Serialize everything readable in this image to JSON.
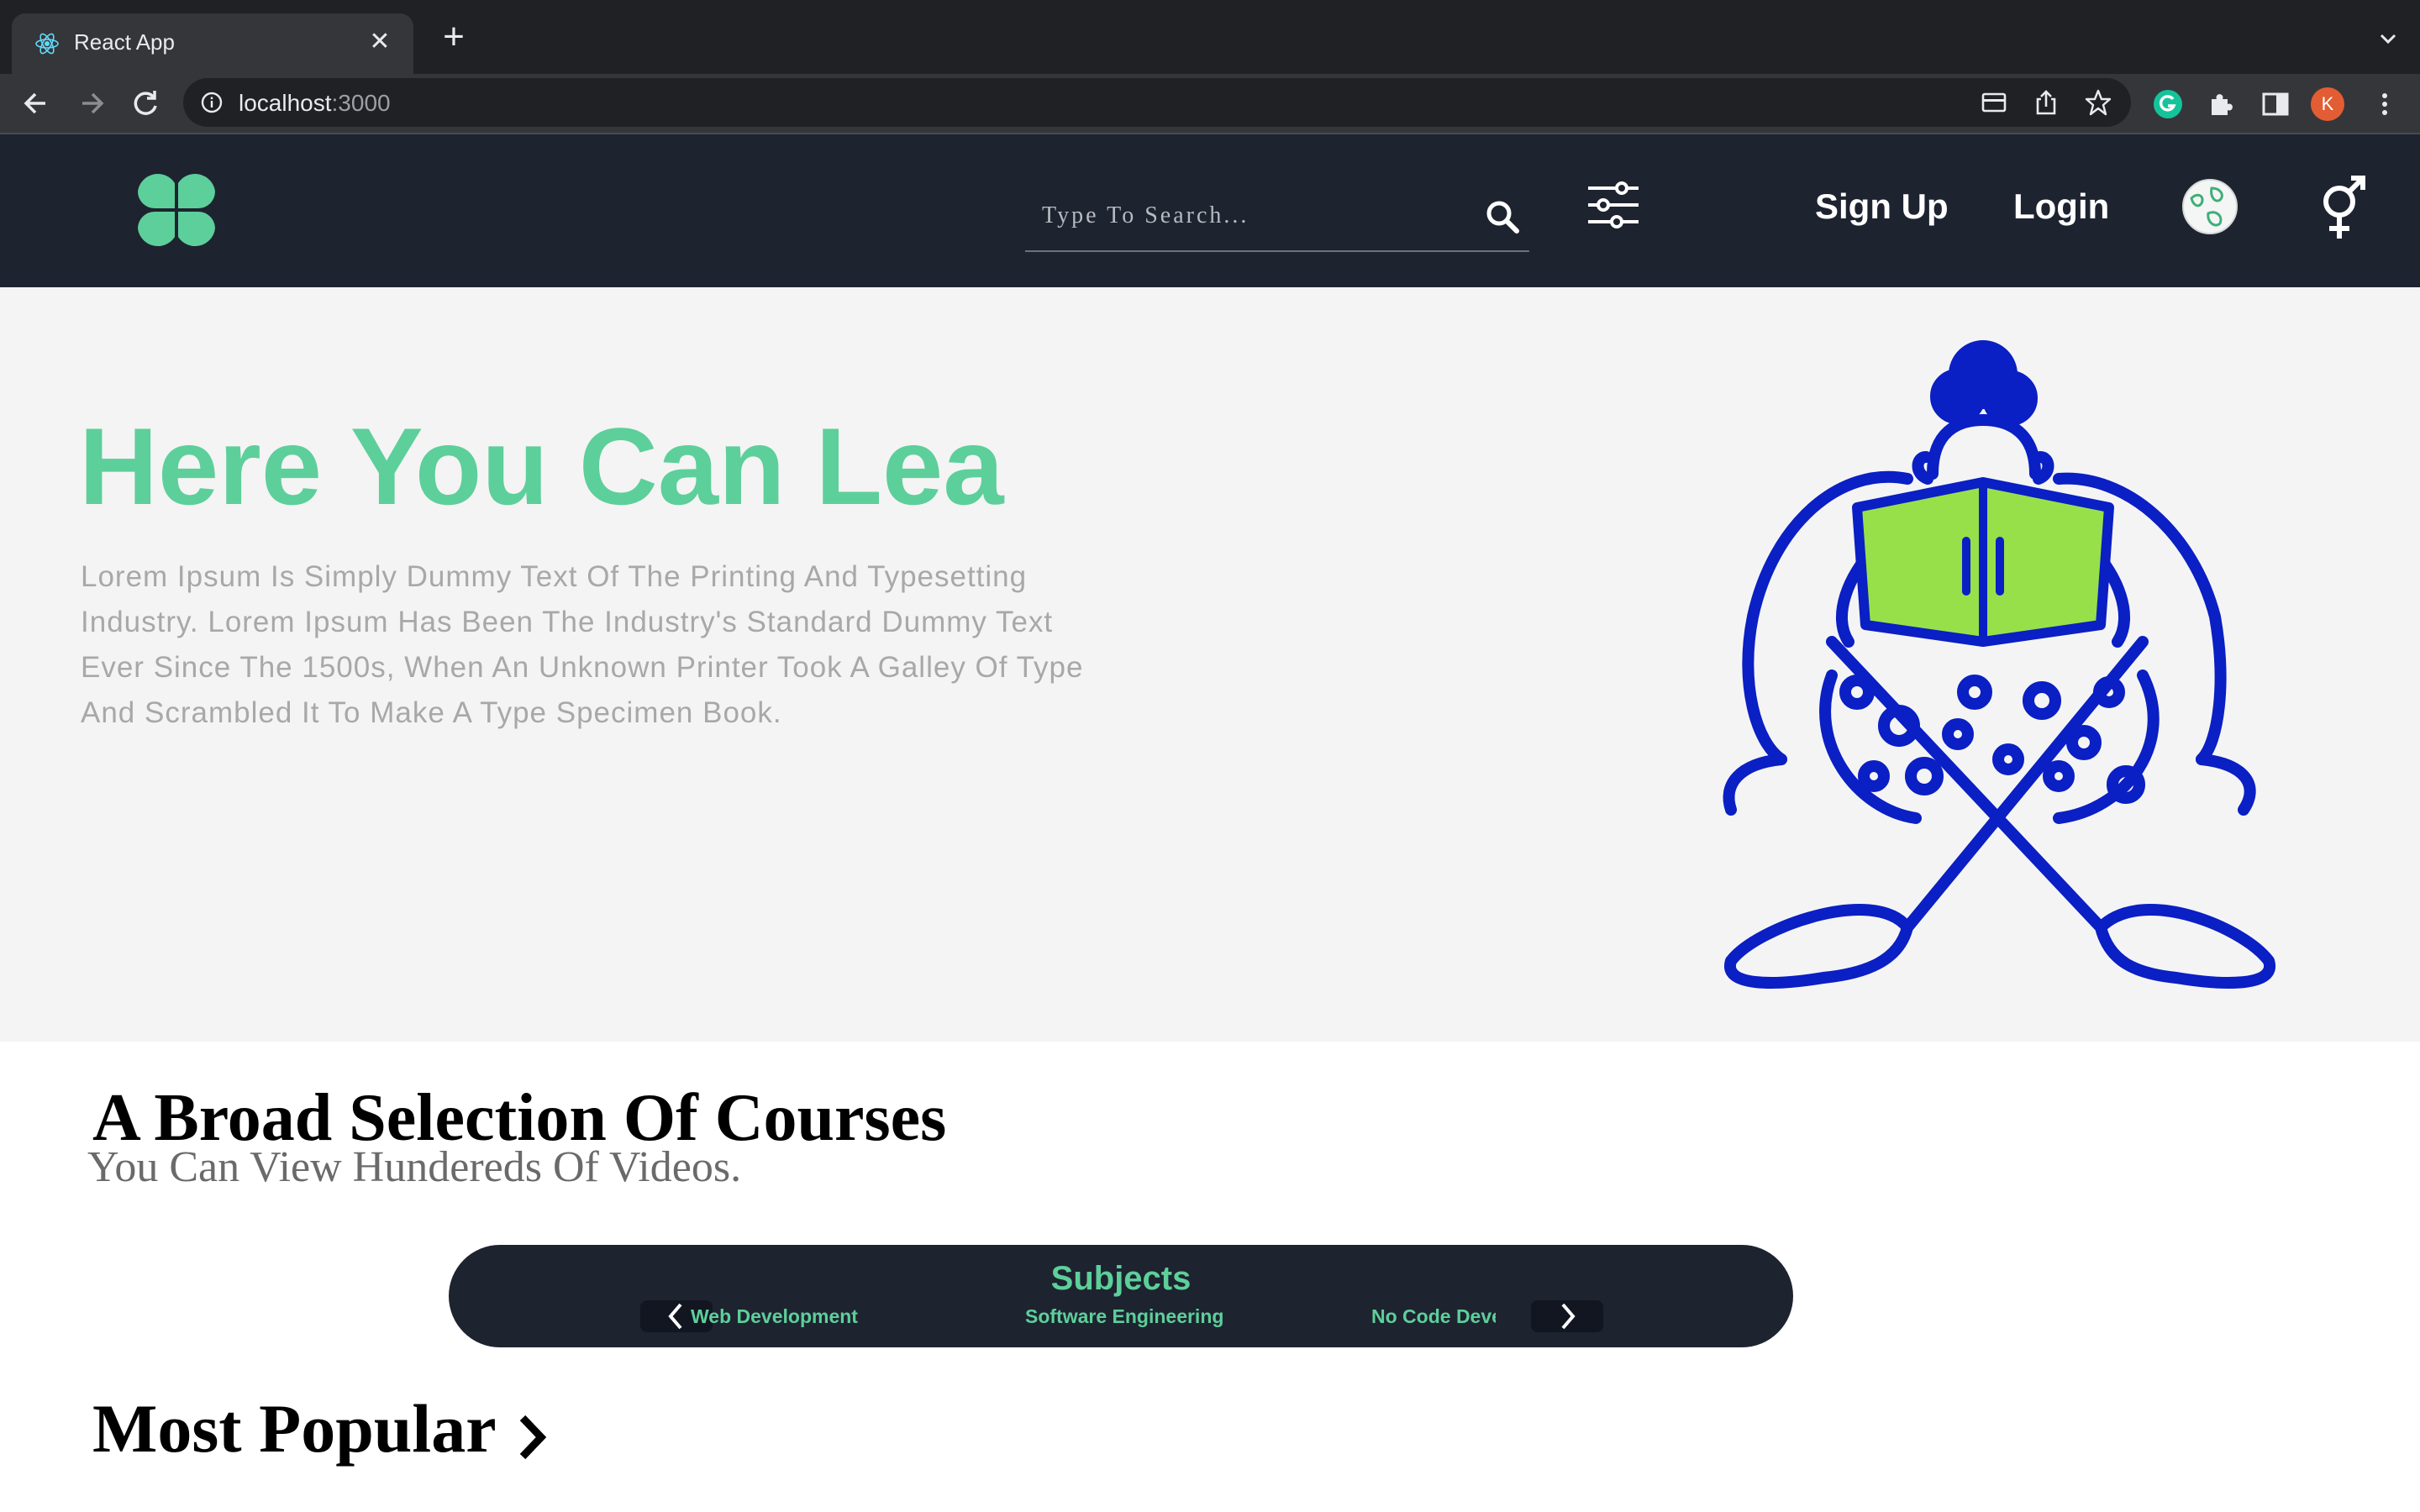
{
  "browser": {
    "tab_title": "React App",
    "url_host": "localhost",
    "url_port": ":3000",
    "profile_initial": "K"
  },
  "header": {
    "search_placeholder": "Type To Search...",
    "signup_label": "Sign Up",
    "login_label": "Login"
  },
  "hero": {
    "title": "Here You Can Lea",
    "text": "Lorem Ipsum Is Simply Dummy Text Of The Printing And Typesetting Industry. Lorem Ipsum Has Been The Industry's Standard Dummy Text Ever Since The 1500s, When An Unknown Printer Took A Galley Of Type And Scrambled It To Make A Type Specimen Book."
  },
  "courses": {
    "title": "A Broad Selection Of Courses",
    "subtitle": "You Can View Hundereds Of Videos."
  },
  "subjects": {
    "title": "Subjects",
    "items": [
      "Web Development",
      "Software Engineering",
      "No Code Development"
    ]
  },
  "popular": {
    "title": "Most Popular"
  },
  "colors": {
    "accent": "#5dcf9a",
    "header_bg": "#1e2330",
    "hero_bg": "#f4f4f4",
    "illustration": "#0a1fc4",
    "book": "#98e04a"
  }
}
